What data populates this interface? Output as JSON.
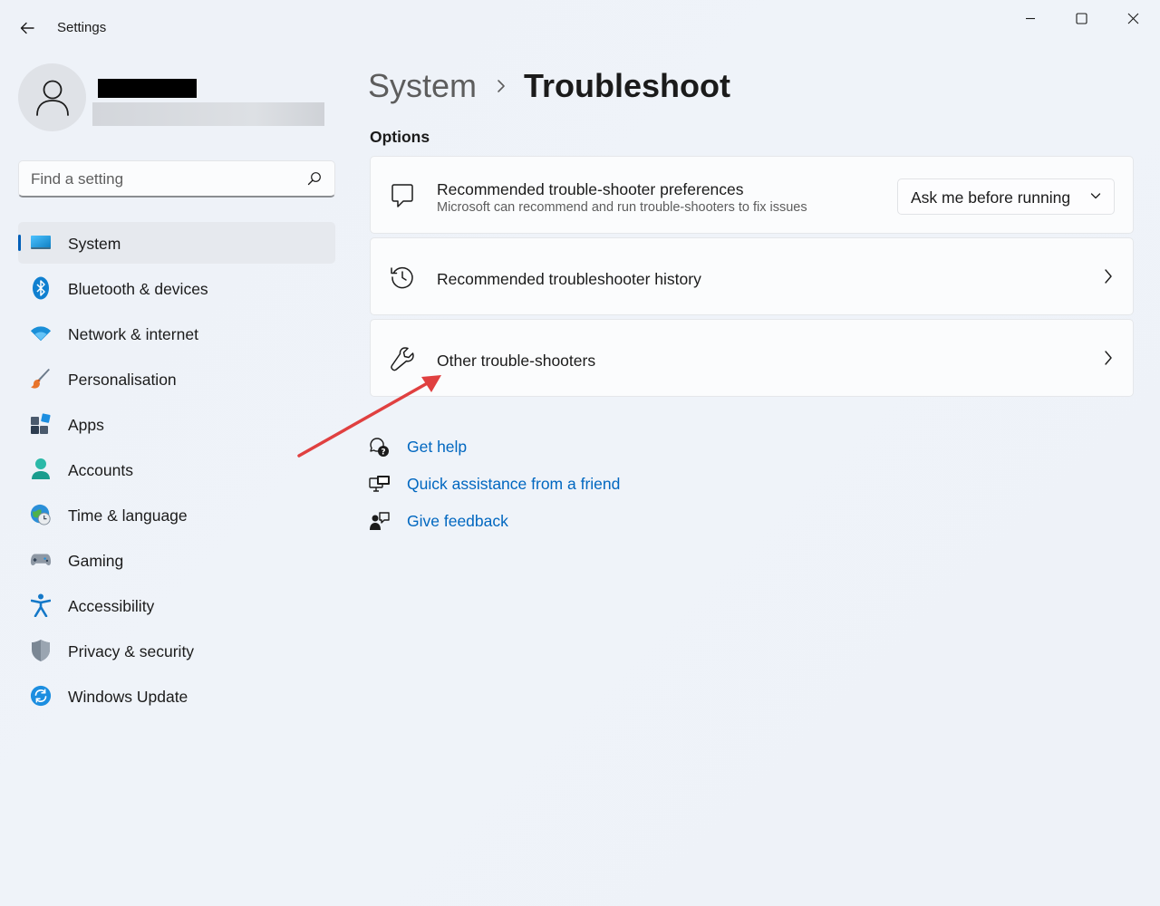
{
  "window": {
    "title": "Settings",
    "controls": [
      "minimize",
      "maximize",
      "close"
    ]
  },
  "search": {
    "placeholder": "Find a setting"
  },
  "sidebar": {
    "items": [
      {
        "label": "System",
        "icon": "system-icon",
        "active": true
      },
      {
        "label": "Bluetooth & devices",
        "icon": "bluetooth-icon"
      },
      {
        "label": "Network & internet",
        "icon": "wifi-icon"
      },
      {
        "label": "Personalisation",
        "icon": "brush-icon"
      },
      {
        "label": "Apps",
        "icon": "apps-icon"
      },
      {
        "label": "Accounts",
        "icon": "accounts-icon"
      },
      {
        "label": "Time & language",
        "icon": "time-language-icon"
      },
      {
        "label": "Gaming",
        "icon": "gamepad-icon"
      },
      {
        "label": "Accessibility",
        "icon": "accessibility-icon"
      },
      {
        "label": "Privacy & security",
        "icon": "shield-icon"
      },
      {
        "label": "Windows Update",
        "icon": "update-icon"
      }
    ]
  },
  "main": {
    "breadcrumb": {
      "parent": "System",
      "current": "Troubleshoot"
    },
    "section_title": "Options",
    "cards": [
      {
        "title": "Recommended trouble-shooter preferences",
        "subtitle": "Microsoft can recommend and run trouble-shooters to fix issues",
        "icon": "chat-bubble-icon",
        "dropdown_value": "Ask me before running"
      },
      {
        "title": "Recommended troubleshooter history",
        "icon": "history-icon"
      },
      {
        "title": "Other trouble-shooters",
        "icon": "wrench-icon"
      }
    ],
    "links": [
      {
        "label": "Get help",
        "icon": "help-chat-icon"
      },
      {
        "label": "Quick assistance from a friend",
        "icon": "remote-assist-icon"
      },
      {
        "label": "Give feedback",
        "icon": "feedback-icon"
      }
    ]
  },
  "colors": {
    "accent": "#005fb8",
    "link": "#0067c0",
    "annotation_arrow": "#e04040"
  }
}
